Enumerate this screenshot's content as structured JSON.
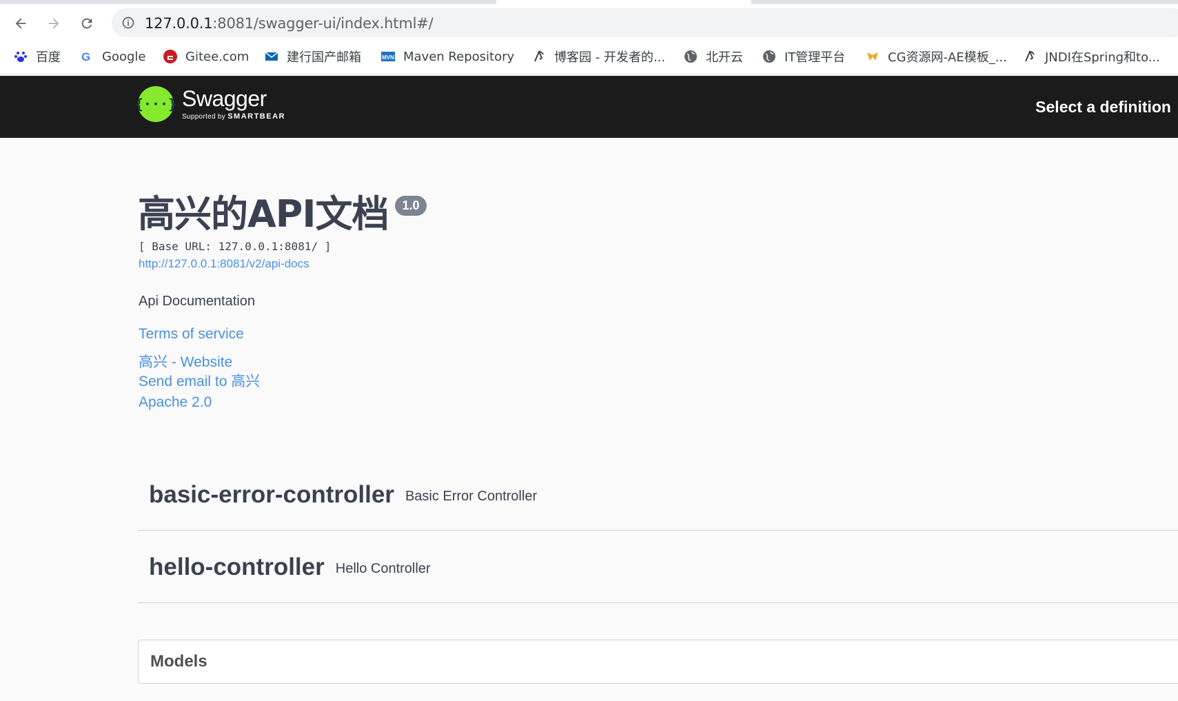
{
  "browser": {
    "url_host": "127.0.0.1",
    "url_path": ":8081/swagger-ui/index.html#/",
    "bookmarks": [
      {
        "label": "百度",
        "icon": "baidu-icon"
      },
      {
        "label": "Google",
        "icon": "google-icon"
      },
      {
        "label": "Gitee.com",
        "icon": "gitee-icon"
      },
      {
        "label": "建行国产邮箱",
        "icon": "mail-icon"
      },
      {
        "label": "Maven Repository",
        "icon": "maven-icon"
      },
      {
        "label": "博客园 - 开发者的...",
        "icon": "cnblogs-icon"
      },
      {
        "label": "北开云",
        "icon": "globe-icon"
      },
      {
        "label": "IT管理平台",
        "icon": "globe-icon"
      },
      {
        "label": "CG资源网-AE模板_...",
        "icon": "cg-icon"
      },
      {
        "label": "JNDI在Spring和to...",
        "icon": "cnblogs-icon"
      }
    ]
  },
  "topbar": {
    "logo_name": "Swagger",
    "logo_sub_prefix": "Supported by",
    "logo_sub_brand": "SMARTBEAR",
    "select_definition": "Select a definition"
  },
  "info": {
    "title": "高兴的API文档",
    "version": "1.0",
    "base_url": "[ Base URL: 127.0.0.1:8081/ ]",
    "api_docs_link": "http://127.0.0.1:8081/v2/api-docs",
    "description": "Api Documentation",
    "terms": "Terms of service",
    "website": "高兴 - Website",
    "email": "Send email to 高兴",
    "license": "Apache 2.0"
  },
  "tags": [
    {
      "name": "basic-error-controller",
      "description": "Basic Error Controller"
    },
    {
      "name": "hello-controller",
      "description": "Hello Controller"
    }
  ],
  "models_label": "Models",
  "colors": {
    "topbar_bg": "#1b1b1b",
    "logo_green": "#85ea2d",
    "link_blue": "#4990e2",
    "text_dark": "#3b4151",
    "version_badge": "#7d8492"
  }
}
